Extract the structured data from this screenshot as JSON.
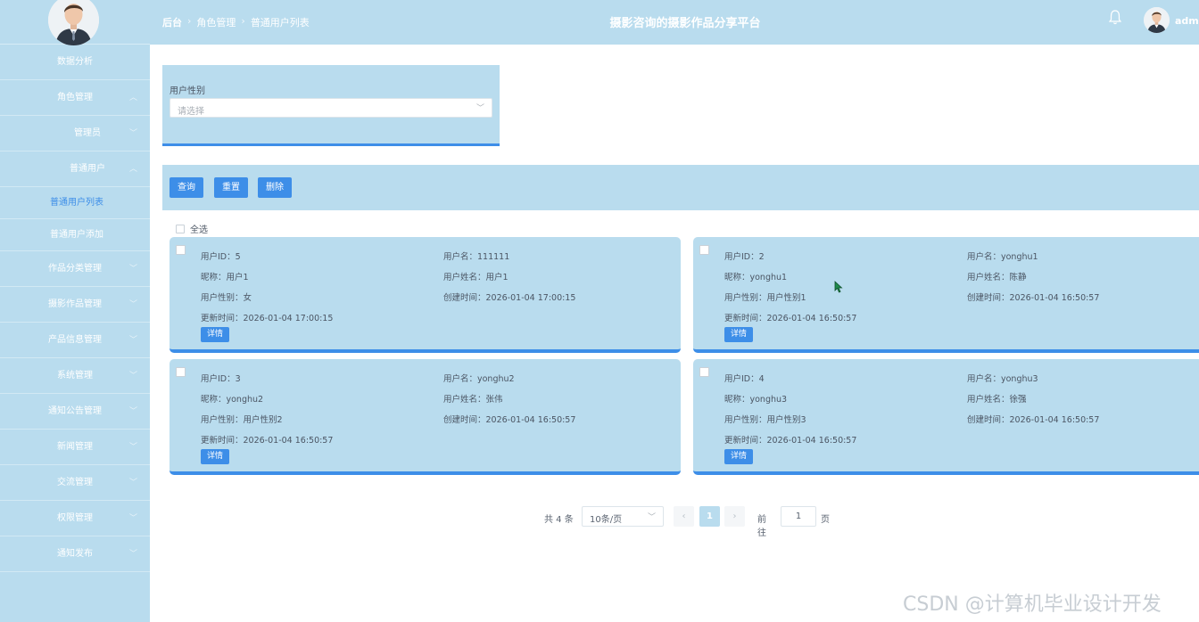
{
  "header": {
    "breadcrumb": [
      "后台",
      "角色管理",
      "普通用户列表"
    ],
    "title": "摄影咨询的摄影作品分享平台",
    "user_name": "admi"
  },
  "sidebar": {
    "items": [
      {
        "label": "数据分析",
        "expand": ""
      },
      {
        "label": "角色管理",
        "expand": "up"
      },
      {
        "label": "管理员",
        "expand": "down"
      },
      {
        "label": "普通用户",
        "expand": "up"
      },
      {
        "label": "普通用户列表",
        "expand": "",
        "active": true
      },
      {
        "label": "普通用户添加",
        "expand": ""
      },
      {
        "label": "作品分类管理",
        "expand": "down"
      },
      {
        "label": "摄影作品管理",
        "expand": "down"
      },
      {
        "label": "产品信息管理",
        "expand": "down"
      },
      {
        "label": "系统管理",
        "expand": "down"
      },
      {
        "label": "通知公告管理",
        "expand": "down"
      },
      {
        "label": "新闻管理",
        "expand": "down"
      },
      {
        "label": "交流管理",
        "expand": "down"
      },
      {
        "label": "权限管理",
        "expand": "down"
      },
      {
        "label": "通知发布",
        "expand": "down"
      }
    ]
  },
  "search": {
    "label": "用户性别",
    "placeholder": "请选择"
  },
  "actions": {
    "query": "查询",
    "reset": "重置",
    "delete": "删除"
  },
  "select_all": "全选",
  "cards": [
    {
      "id": "用户ID：5",
      "username": "用户名：111111",
      "nickname": "昵称：用户1",
      "realname": "用户姓名：用户1",
      "gender": "用户性别：女",
      "created": "创建时间：2026-01-04 17:00:15",
      "updated": "更新时间：2026-01-04 17:00:15",
      "detail": "详情"
    },
    {
      "id": "用户ID：2",
      "username": "用户名：yonghu1",
      "nickname": "昵称：yonghu1",
      "realname": "用户姓名：陈静",
      "gender": "用户性别：用户性别1",
      "created": "创建时间：2026-01-04 16:50:57",
      "updated": "更新时间：2026-01-04 16:50:57",
      "detail": "详情"
    },
    {
      "id": "用户ID：3",
      "username": "用户名：yonghu2",
      "nickname": "昵称：yonghu2",
      "realname": "用户姓名：张伟",
      "gender": "用户性别：用户性别2",
      "created": "创建时间：2026-01-04 16:50:57",
      "updated": "更新时间：2026-01-04 16:50:57",
      "detail": "详情"
    },
    {
      "id": "用户ID：4",
      "username": "用户名：yonghu3",
      "nickname": "昵称：yonghu3",
      "realname": "用户姓名：徐强",
      "gender": "用户性别：用户性别3",
      "created": "创建时间：2026-01-04 16:50:57",
      "updated": "更新时间：2026-01-04 16:50:57",
      "detail": "详情"
    }
  ],
  "pagination": {
    "total": "共 4 条",
    "page_size": "10条/页",
    "prev": "‹",
    "current": "1",
    "next": "›",
    "goto": "前往",
    "goto_value": "1",
    "page_suffix": "页"
  },
  "watermark": "CSDN @计算机毕业设计开发",
  "colors": {
    "panel": "#b9dcee",
    "accent": "#3d8ee8",
    "white": "#ffffff"
  }
}
